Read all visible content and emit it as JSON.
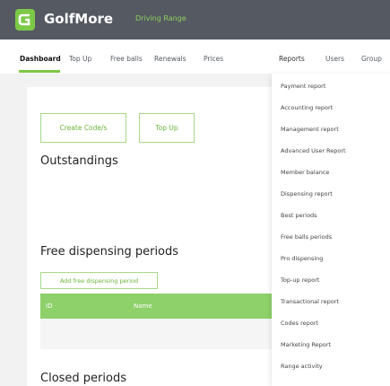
{
  "app": {
    "name": "GolfMore",
    "subtitle": "Driving Range",
    "brand_color": "#7cc947",
    "topbar_color": "#555a62"
  },
  "nav": {
    "items": [
      "Dashboard",
      "Top Up",
      "Free balls",
      "Renewals",
      "Prices",
      "Reports",
      "Users",
      "Group"
    ],
    "active": "Dashboard",
    "open_menu": "Reports"
  },
  "main": {
    "create_code_label": "Create Code/s",
    "top_up_label": "Top Up",
    "outstandings_heading": "Outstandings",
    "free_periods_heading": "Free dispensing periods",
    "add_free_period_label": "Add free dispensing period",
    "table_columns": [
      "ID",
      "Name"
    ],
    "closed_periods_heading": "Closed periods"
  },
  "reports_menu": {
    "items": [
      "Payment report",
      "Accounting report",
      "Management report",
      "Advanced User Report",
      "Member balance",
      "Dispensing report",
      "Best periods",
      "Free balls periods",
      "Pro dispensing",
      "Top-up report",
      "Transactional report",
      "Codes report",
      "Marketing Report",
      "Range activity"
    ]
  }
}
